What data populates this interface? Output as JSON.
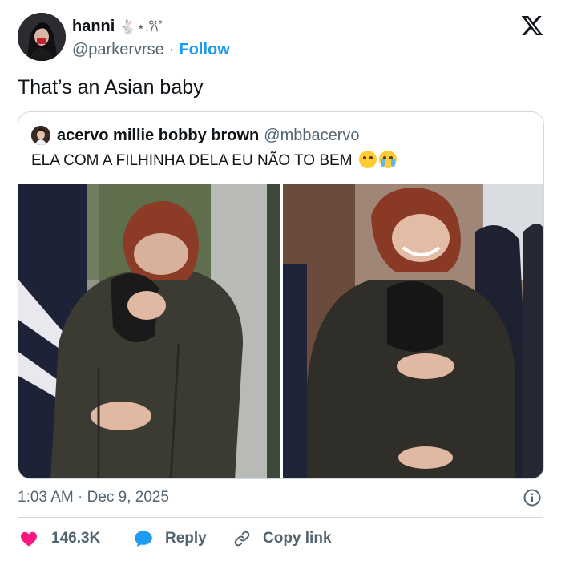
{
  "post": {
    "display_name": "hanni",
    "name_decoration": "🐇⋆.𐙚˚",
    "handle": "@parkervrse",
    "separator": "·",
    "follow_label": "Follow",
    "text": "That’s an Asian baby",
    "timestamp": "1:03 AM · Dec 9, 2025"
  },
  "quoted_post": {
    "display_name": "acervo millie bobby brown",
    "handle": "@mbbacervo",
    "text": "ELA COM A FILHINHA DELA EU NÃO TO BEM",
    "emojis": [
      "pleading-face-emoji",
      "crying-face-emoji"
    ]
  },
  "actions": {
    "like_count": "146.3K",
    "reply_label": "Reply",
    "copy_label": "Copy link"
  },
  "colors": {
    "accent": "#1d9bf0",
    "like": "#f91880",
    "text_primary": "#0f1419",
    "text_secondary": "#536471",
    "border": "#cfd9de"
  },
  "icons": [
    "x-logo-icon",
    "info-icon",
    "heart-icon",
    "reply-bubble-icon",
    "link-icon"
  ]
}
